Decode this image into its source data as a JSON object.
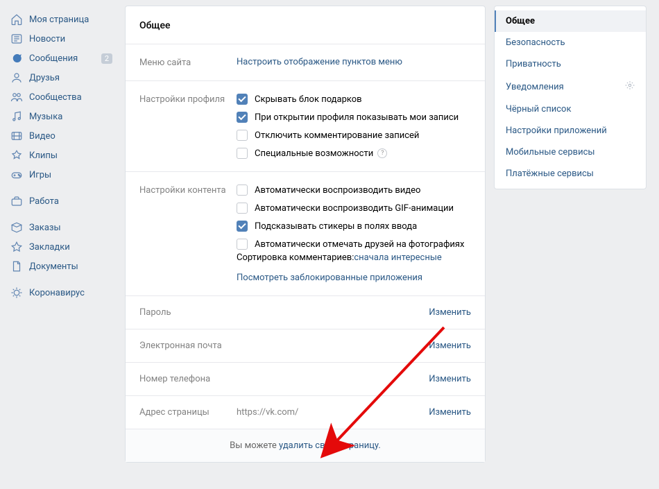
{
  "sidebar": {
    "items": [
      {
        "label": "Моя страница",
        "icon": "home"
      },
      {
        "label": "Новости",
        "icon": "news"
      },
      {
        "label": "Сообщения",
        "icon": "msg",
        "badge": "2"
      },
      {
        "label": "Друзья",
        "icon": "user"
      },
      {
        "label": "Сообщества",
        "icon": "users"
      },
      {
        "label": "Музыка",
        "icon": "music"
      },
      {
        "label": "Видео",
        "icon": "video"
      },
      {
        "label": "Клипы",
        "icon": "clips"
      },
      {
        "label": "Игры",
        "icon": "games"
      }
    ],
    "items2": [
      {
        "label": "Работа",
        "icon": "work"
      }
    ],
    "items3": [
      {
        "label": "Заказы",
        "icon": "box"
      },
      {
        "label": "Закладки",
        "icon": "star"
      },
      {
        "label": "Документы",
        "icon": "doc"
      }
    ],
    "items4": [
      {
        "label": "Коронавирус",
        "icon": "virus"
      }
    ]
  },
  "page": {
    "title": "Общее",
    "menu_row_label": "Меню сайта",
    "menu_link": "Настроить отображение пунктов меню",
    "profile_row_label": "Настройки профиля",
    "profile_checks": [
      {
        "label": "Скрывать блок подарков",
        "checked": true
      },
      {
        "label": "При открытии профиля показывать мои записи",
        "checked": true
      },
      {
        "label": "Отключить комментирование записей",
        "checked": false
      },
      {
        "label": "Специальные возможности",
        "checked": false,
        "help": true
      }
    ],
    "content_row_label": "Настройки контента",
    "content_checks": [
      {
        "label": "Автоматически воспроизводить видео",
        "checked": false
      },
      {
        "label": "Автоматически воспроизводить GIF-анимации",
        "checked": false
      },
      {
        "label": "Подсказывать стикеры в полях ввода",
        "checked": true
      },
      {
        "label": "Автоматически отмечать друзей на фотографиях",
        "checked": false
      }
    ],
    "comments_sort_label": "Сортировка комментариев: ",
    "comments_sort_link": "сначала интересные",
    "blocked_apps_link": "Посмотреть заблокированные приложения",
    "rows": [
      {
        "label": "Пароль",
        "value": "",
        "action": "Изменить"
      },
      {
        "label": "Электронная почта",
        "value": "",
        "action": "Изменить"
      },
      {
        "label": "Номер телефона",
        "value": "",
        "action": "Изменить"
      },
      {
        "label": "Адрес страницы",
        "value": "https://vk.com/",
        "action": "Изменить"
      }
    ],
    "footer_text": "Вы можете ",
    "footer_link": "удалить свою страницу."
  },
  "right_nav": {
    "items": [
      {
        "label": "Общее",
        "active": true
      },
      {
        "label": "Безопасность"
      },
      {
        "label": "Приватность"
      },
      {
        "label": "Уведомления",
        "gear": true
      },
      {
        "label": "Чёрный список"
      },
      {
        "label": "Настройки приложений"
      },
      {
        "label": "Мобильные сервисы"
      },
      {
        "label": "Платёжные сервисы"
      }
    ]
  }
}
